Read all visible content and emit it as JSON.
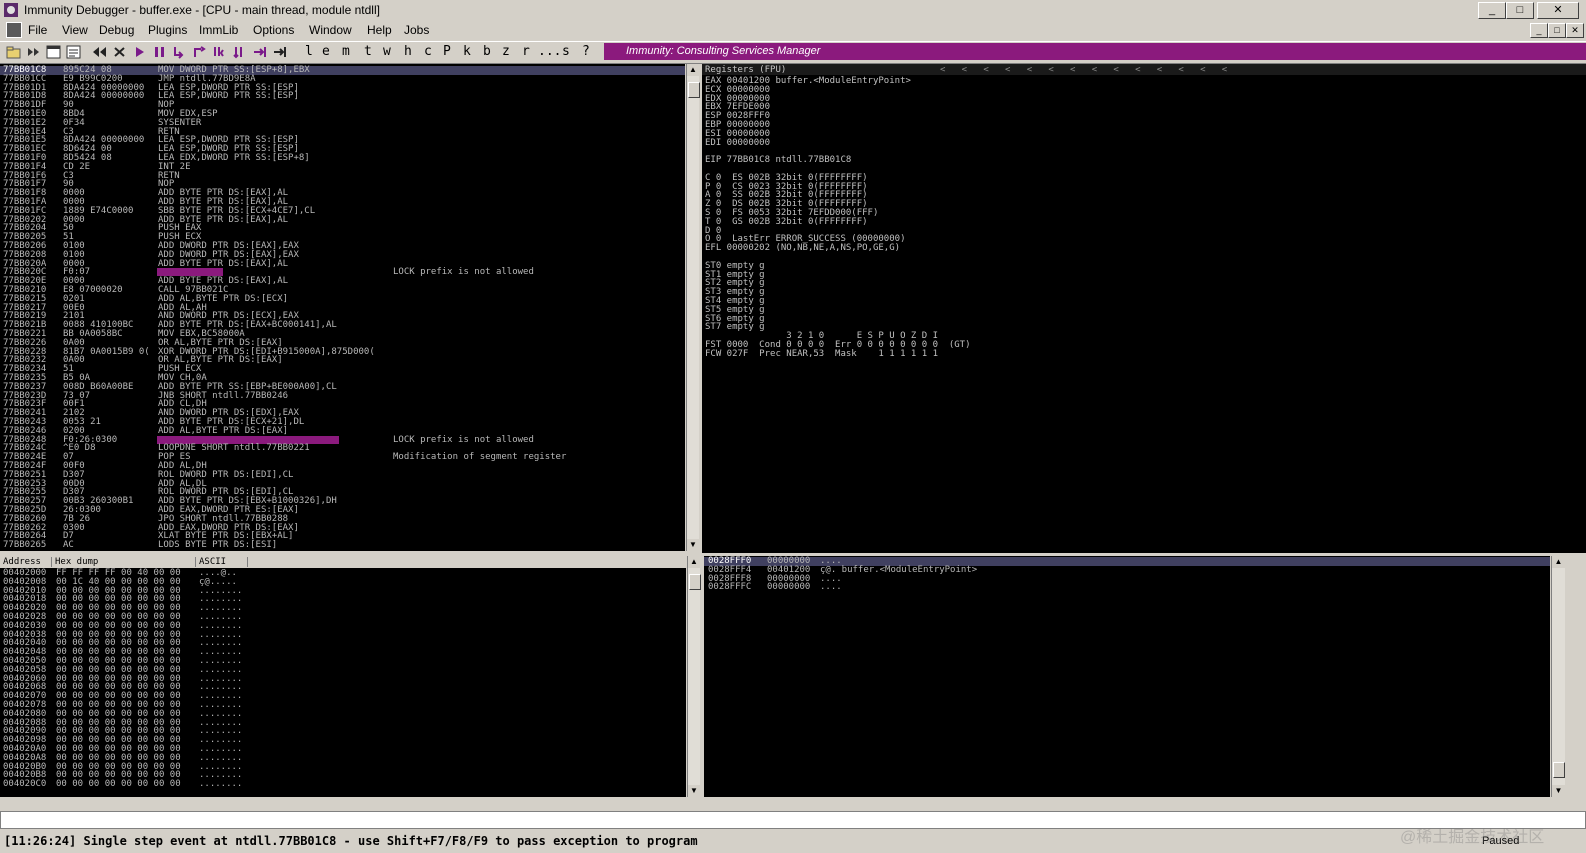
{
  "window": {
    "title": "Immunity Debugger - buffer.exe - [CPU - main thread, module ntdll]"
  },
  "window_controls": {
    "minimize": "_",
    "maximize": "□",
    "close": "✕"
  },
  "menu": [
    "File",
    "View",
    "Debug",
    "Plugins",
    "ImmLib",
    "Options",
    "Window",
    "Help",
    "Jobs"
  ],
  "toolbar_letters": [
    "l",
    "e",
    "m",
    "t",
    "w",
    "h",
    "c",
    "P",
    "k",
    "b",
    "z",
    "r",
    "...",
    "s",
    "?"
  ],
  "banner": {
    "text": "Immunity: Consulting Services Manager"
  },
  "colors": {
    "highlight": "#8b1a7d",
    "current_row": "#404060",
    "banner": "#8b1a7d"
  },
  "disasm": [
    {
      "addr": "77BB01C8",
      "hex": "895C24 08",
      "instr": "MOV DWORD PTR SS:[ESP+8],EBX",
      "comment": "",
      "current": true
    },
    {
      "addr": "77BB01CC",
      "hex": "E9 B99C0200",
      "instr": "JMP ntdll.77BD9E8A",
      "comment": ""
    },
    {
      "addr": "77BB01D1",
      "hex": "8DA424 00000000",
      "instr": "LEA ESP,DWORD PTR SS:[ESP]",
      "comment": ""
    },
    {
      "addr": "77BB01D8",
      "hex": "8DA424 00000000",
      "instr": "LEA ESP,DWORD PTR SS:[ESP]",
      "comment": ""
    },
    {
      "addr": "77BB01DF",
      "hex": "90",
      "instr": "NOP",
      "comment": ""
    },
    {
      "addr": "77BB01E0",
      "hex": "8BD4",
      "instr": "MOV EDX,ESP",
      "comment": ""
    },
    {
      "addr": "77BB01E2",
      "hex": "0F34",
      "instr": "SYSENTER",
      "comment": ""
    },
    {
      "addr": "77BB01E4",
      "hex": "C3",
      "instr": "RETN",
      "comment": ""
    },
    {
      "addr": "77BB01E5",
      "hex": "8DA424 00000000",
      "instr": "LEA ESP,DWORD PTR SS:[ESP]",
      "comment": ""
    },
    {
      "addr": "77BB01EC",
      "hex": "8D6424 00",
      "instr": "LEA ESP,DWORD PTR SS:[ESP]",
      "comment": ""
    },
    {
      "addr": "77BB01F0",
      "hex": "8D5424 08",
      "instr": "LEA EDX,DWORD PTR SS:[ESP+8]",
      "comment": ""
    },
    {
      "addr": "77BB01F4",
      "hex": "CD 2E",
      "instr": "INT 2E",
      "comment": ""
    },
    {
      "addr": "77BB01F6",
      "hex": "C3",
      "instr": "RETN",
      "comment": ""
    },
    {
      "addr": "77BB01F7",
      "hex": "90",
      "instr": "NOP",
      "comment": ""
    },
    {
      "addr": "77BB01F8",
      "hex": "0000",
      "instr": "ADD BYTE PTR DS:[EAX],AL",
      "comment": ""
    },
    {
      "addr": "77BB01FA",
      "hex": "0000",
      "instr": "ADD BYTE PTR DS:[EAX],AL",
      "comment": ""
    },
    {
      "addr": "77BB01FC",
      "hex": "1889 E74C0000",
      "instr": "SBB BYTE PTR DS:[ECX+4CE7],CL",
      "comment": ""
    },
    {
      "addr": "77BB0202",
      "hex": "0000",
      "instr": "ADD BYTE PTR DS:[EAX],AL",
      "comment": ""
    },
    {
      "addr": "77BB0204",
      "hex": "50",
      "instr": "PUSH EAX",
      "comment": ""
    },
    {
      "addr": "77BB0205",
      "hex": "51",
      "instr": "PUSH ECX",
      "comment": ""
    },
    {
      "addr": "77BB0206",
      "hex": "0100",
      "instr": "ADD DWORD PTR DS:[EAX],EAX",
      "comment": ""
    },
    {
      "addr": "77BB0208",
      "hex": "0100",
      "instr": "ADD DWORD PTR DS:[EAX],EAX",
      "comment": ""
    },
    {
      "addr": "77BB020A",
      "hex": "0000",
      "instr": "ADD BYTE PTR DS:[EAX],AL",
      "comment": ""
    },
    {
      "addr": "77BB020C",
      "hex": "F0:07",
      "instr": "",
      "comment": "LOCK prefix is not allowed",
      "hl": true,
      "hlw": 66
    },
    {
      "addr": "77BB020E",
      "hex": "0000",
      "instr": "ADD BYTE PTR DS:[EAX],AL",
      "comment": ""
    },
    {
      "addr": "77BB0210",
      "hex": "E8 07000020",
      "instr": "CALL 97BB021C",
      "comment": ""
    },
    {
      "addr": "77BB0215",
      "hex": "0201",
      "instr": "ADD AL,BYTE PTR DS:[ECX]",
      "comment": ""
    },
    {
      "addr": "77BB0217",
      "hex": "00E0",
      "instr": "ADD AL,AH",
      "comment": ""
    },
    {
      "addr": "77BB0219",
      "hex": "2101",
      "instr": "AND DWORD PTR DS:[ECX],EAX",
      "comment": ""
    },
    {
      "addr": "77BB021B",
      "hex": "0088 410100BC",
      "instr": "ADD BYTE PTR DS:[EAX+BC000141],AL",
      "comment": ""
    },
    {
      "addr": "77BB0221",
      "hex": "BB 0A0058BC",
      "instr": "MOV EBX,BC58000A",
      "comment": ""
    },
    {
      "addr": "77BB0226",
      "hex": "0A00",
      "instr": "OR AL,BYTE PTR DS:[EAX]",
      "comment": ""
    },
    {
      "addr": "77BB0228",
      "hex": "81B7 0A0015B9 0(",
      "instr": "XOR DWORD PTR DS:[EDI+B915000A],875D000(",
      "comment": ""
    },
    {
      "addr": "77BB0232",
      "hex": "0A00",
      "instr": "OR AL,BYTE PTR DS:[EAX]",
      "comment": ""
    },
    {
      "addr": "77BB0234",
      "hex": "51",
      "instr": "PUSH ECX",
      "comment": ""
    },
    {
      "addr": "77BB0235",
      "hex": "B5 0A",
      "instr": "MOV CH,0A",
      "comment": ""
    },
    {
      "addr": "77BB0237",
      "hex": "008D B60A00BE",
      "instr": "ADD BYTE PTR SS:[EBP+BE000A00],CL",
      "comment": ""
    },
    {
      "addr": "77BB023D",
      "hex": "73 07",
      "instr": "JNB SHORT ntdll.77BB0246",
      "comment": ""
    },
    {
      "addr": "77BB023F",
      "hex": "00F1",
      "instr": "ADD CL,DH",
      "comment": ""
    },
    {
      "addr": "77BB0241",
      "hex": "2102",
      "instr": "AND DWORD PTR DS:[EDX],EAX",
      "comment": ""
    },
    {
      "addr": "77BB0243",
      "hex": "0053 21",
      "instr": "ADD BYTE PTR DS:[ECX+21],DL",
      "comment": ""
    },
    {
      "addr": "77BB0246",
      "hex": "0200",
      "instr": "ADD AL,BYTE PTR DS:[EAX]",
      "comment": ""
    },
    {
      "addr": "77BB0248",
      "hex": "F0:26:0300",
      "instr": "",
      "comment": "LOCK prefix is not allowed",
      "hl": true,
      "hlw": 182
    },
    {
      "addr": "77BB024C",
      "hex": "^E0 D8",
      "instr": "LOOPDNE SHORT ntdll.77BB0221",
      "comment": ""
    },
    {
      "addr": "77BB024E",
      "hex": "07",
      "instr": "POP ES",
      "comment": "Modification of segment register"
    },
    {
      "addr": "77BB024F",
      "hex": "00F0",
      "instr": "ADD AL,DH",
      "comment": ""
    },
    {
      "addr": "77BB0251",
      "hex": "D307",
      "instr": "ROL DWORD PTR DS:[EDI],CL",
      "comment": ""
    },
    {
      "addr": "77BB0253",
      "hex": "00D0",
      "instr": "ADD AL,DL",
      "comment": ""
    },
    {
      "addr": "77BB0255",
      "hex": "D307",
      "instr": "ROL DWORD PTR DS:[EDI],CL",
      "comment": ""
    },
    {
      "addr": "77BB0257",
      "hex": "00B3 260300B1",
      "instr": "ADD BYTE PTR DS:[EBX+B1000326],DH",
      "comment": ""
    },
    {
      "addr": "77BB025D",
      "hex": "26:0300",
      "instr": "ADD EAX,DWORD PTR ES:[EAX]",
      "comment": ""
    },
    {
      "addr": "77BB0260",
      "hex": "7B 26",
      "instr": "JPO SHORT ntdll.77BB0288",
      "comment": ""
    },
    {
      "addr": "77BB0262",
      "hex": "0300",
      "instr": "ADD EAX,DWORD PTR DS:[EAX]",
      "comment": ""
    },
    {
      "addr": "77BB0264",
      "hex": "D7",
      "instr": "XLAT BYTE PTR DS:[EBX+AL]",
      "comment": ""
    },
    {
      "addr": "77BB0265",
      "hex": "AC",
      "instr": "LODS BYTE PTR DS:[ESI]",
      "comment": ""
    }
  ],
  "registers": {
    "header": "Registers (FPU)",
    "header_arrows": "<   <   <   <   <   <   <   <   <   <   <   <   <   <",
    "lines": [
      "EAX 00401200 buffer.<ModuleEntryPoint>",
      "ECX 00000000",
      "EDX 00000000",
      "EBX 7EFDE000",
      "ESP 0028FFF0",
      "EBP 00000000",
      "ESI 00000000",
      "EDI 00000000",
      "",
      "EIP 77BB01C8 ntdll.77BB01C8",
      "",
      "C 0  ES 002B 32bit 0(FFFFFFFF)",
      "P 0  CS 0023 32bit 0(FFFFFFFF)",
      "A 0  SS 002B 32bit 0(FFFFFFFF)",
      "Z 0  DS 002B 32bit 0(FFFFFFFF)",
      "S 0  FS 0053 32bit 7EFDD000(FFF)",
      "T 0  GS 002B 32bit 0(FFFFFFFF)",
      "D 0",
      "O 0  LastErr ERROR_SUCCESS (00000000)",
      "EFL 00000202 (NO,NB,NE,A,NS,PO,GE,G)",
      "",
      "ST0 empty g",
      "ST1 empty g",
      "ST2 empty g",
      "ST3 empty g",
      "ST4 empty g",
      "ST5 empty g",
      "ST6 empty g",
      "ST7 empty g",
      "               3 2 1 0      E S P U O Z D I",
      "FST 0000  Cond 0 0 0 0  Err 0 0 0 0 0 0 0 0  (GT)",
      "FCW 027F  Prec NEAR,53  Mask    1 1 1 1 1 1"
    ]
  },
  "dump": {
    "headers": {
      "address": "Address",
      "hex": "Hex dump",
      "ascii": "ASCII"
    },
    "rows": [
      {
        "addr": "00402000",
        "hex": "FF FF FF FF 00 40 00 00",
        "ascii": "....@.."
      },
      {
        "addr": "00402008",
        "hex": "00 1C 40 00 00 00 00 00",
        "ascii": "ç@....."
      },
      {
        "addr": "00402010",
        "hex": "00 00 00 00 00 00 00 00",
        "ascii": "........"
      },
      {
        "addr": "00402018",
        "hex": "00 00 00 00 00 00 00 00",
        "ascii": "........"
      },
      {
        "addr": "00402020",
        "hex": "00 00 00 00 00 00 00 00",
        "ascii": "........"
      },
      {
        "addr": "00402028",
        "hex": "00 00 00 00 00 00 00 00",
        "ascii": "........"
      },
      {
        "addr": "00402030",
        "hex": "00 00 00 00 00 00 00 00",
        "ascii": "........"
      },
      {
        "addr": "00402038",
        "hex": "00 00 00 00 00 00 00 00",
        "ascii": "........"
      },
      {
        "addr": "00402040",
        "hex": "00 00 00 00 00 00 00 00",
        "ascii": "........"
      },
      {
        "addr": "00402048",
        "hex": "00 00 00 00 00 00 00 00",
        "ascii": "........"
      },
      {
        "addr": "00402050",
        "hex": "00 00 00 00 00 00 00 00",
        "ascii": "........"
      },
      {
        "addr": "00402058",
        "hex": "00 00 00 00 00 00 00 00",
        "ascii": "........"
      },
      {
        "addr": "00402060",
        "hex": "00 00 00 00 00 00 00 00",
        "ascii": "........"
      },
      {
        "addr": "00402068",
        "hex": "00 00 00 00 00 00 00 00",
        "ascii": "........"
      },
      {
        "addr": "00402070",
        "hex": "00 00 00 00 00 00 00 00",
        "ascii": "........"
      },
      {
        "addr": "00402078",
        "hex": "00 00 00 00 00 00 00 00",
        "ascii": "........"
      },
      {
        "addr": "00402080",
        "hex": "00 00 00 00 00 00 00 00",
        "ascii": "........"
      },
      {
        "addr": "00402088",
        "hex": "00 00 00 00 00 00 00 00",
        "ascii": "........"
      },
      {
        "addr": "00402090",
        "hex": "00 00 00 00 00 00 00 00",
        "ascii": "........"
      },
      {
        "addr": "00402098",
        "hex": "00 00 00 00 00 00 00 00",
        "ascii": "........"
      },
      {
        "addr": "004020A0",
        "hex": "00 00 00 00 00 00 00 00",
        "ascii": "........"
      },
      {
        "addr": "004020A8",
        "hex": "00 00 00 00 00 00 00 00",
        "ascii": "........"
      },
      {
        "addr": "004020B0",
        "hex": "00 00 00 00 00 00 00 00",
        "ascii": "........"
      },
      {
        "addr": "004020B8",
        "hex": "00 00 00 00 00 00 00 00",
        "ascii": "........"
      },
      {
        "addr": "004020C0",
        "hex": "00 00 00 00 00 00 00 00",
        "ascii": "........"
      }
    ]
  },
  "stack": [
    {
      "addr": "0028FFF0",
      "val": "00000000",
      "comment": "....",
      "current": true
    },
    {
      "addr": "0028FFF4",
      "val": "00401200",
      "comment": "ç@. buffer.<ModuleEntryPoint>"
    },
    {
      "addr": "0028FFF8",
      "val": "00000000",
      "comment": "...."
    },
    {
      "addr": "0028FFFC",
      "val": "00000000",
      "comment": "...."
    }
  ],
  "status": {
    "message": "[11:26:24] Single step event at ntdll.77BB01C8 - use Shift+F7/F8/F9 to pass exception to program",
    "state": "Paused"
  },
  "watermark": "@稀土掘金技术社区"
}
